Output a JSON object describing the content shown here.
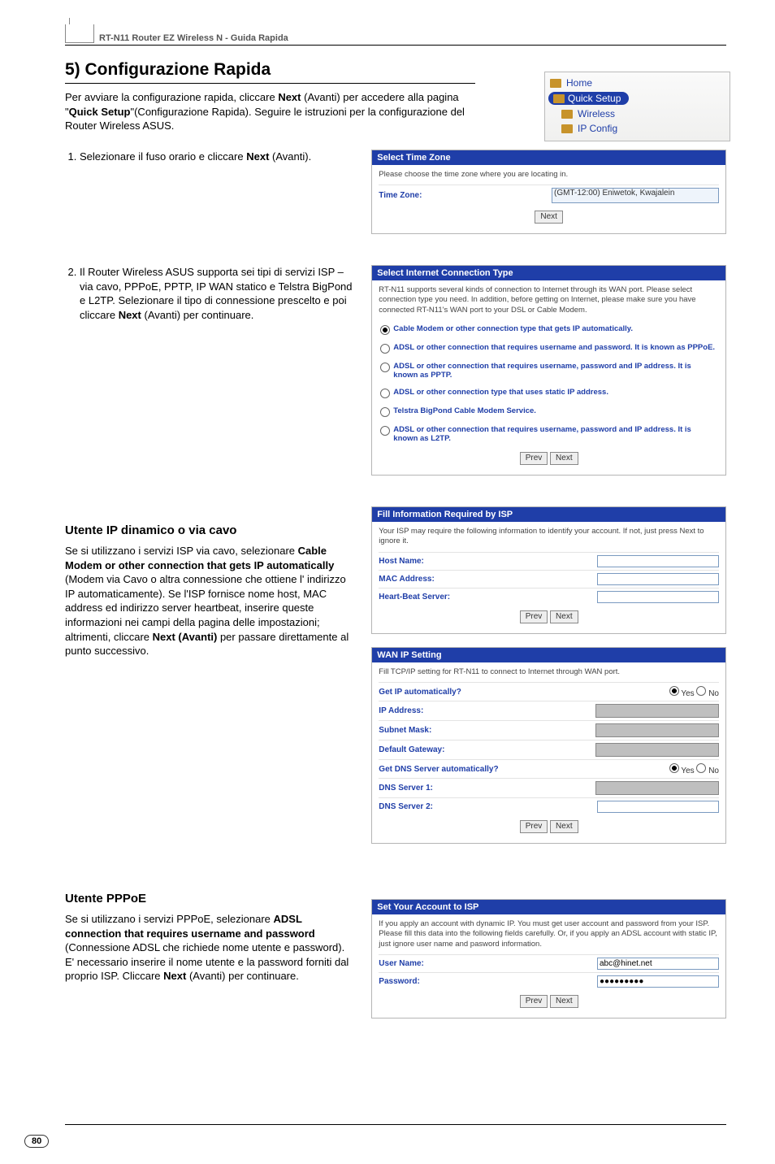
{
  "header": "RT-N11 Router EZ Wireless N - Guida Rapida",
  "section_title": "5) Configurazione Rapida",
  "intro": "Per avviare la configurazione rapida, cliccare Next (Avanti) per accedere alla pagina \"Quick Setup\"(Configurazione Rapida). Seguire le istruzioni per la configurazione del Router Wireless ASUS.",
  "nav": {
    "home": "Home",
    "quick": "Quick Setup",
    "wireless": "Wireless",
    "ipconfig": "IP Config"
  },
  "step1": "Selezionare il fuso orario e cliccare Next (Avanti).",
  "step2": "Il Router Wireless ASUS  supporta sei tipi di servizi ISP – via cavo, PPPoE, PPTP, IP WAN statico e Telstra BigPond e L2TP. Selezionare il tipo di connessione prescelto e poi cliccare Next (Avanti) per continuare.",
  "dyn_head": "Utente IP dinamico o via cavo",
  "dyn_body": "Se si utilizzano i servizi ISP via cavo, selezionare Cable Modem or other connection that gets IP automatically (Modem via Cavo o altra connessione che ottiene l' indirizzo IP automaticamente). Se l'ISP fornisce nome host, MAC address ed indirizzo server heartbeat, inserire queste informazioni nei campi della pagina delle impostazioni; altrimenti, cliccare Next (Avanti) per passare direttamente al punto successivo.",
  "pppoe_head": "Utente PPPoE",
  "pppoe_body": "Se si utilizzano i servizi PPPoE, selezionare ADSL connection that requires username and password (Connessione ADSL che richiede nome utente e password). E' necessario inserire il nome utente e la password forniti dal proprio ISP. Cliccare Next (Avanti) per continuare.",
  "panel_tz": {
    "title": "Select Time Zone",
    "desc": "Please choose the time zone where you are locating in.",
    "label": "Time Zone:",
    "value": "(GMT-12:00) Eniwetok, Kwajalein",
    "next": "Next"
  },
  "panel_conn": {
    "title": "Select Internet Connection Type",
    "desc": "RT-N11 supports several kinds of connection to Internet through its WAN port. Please select connection type you need. In addition, before getting on Internet, please make sure you have connected  RT-N11's WAN port to your DSL or Cable Modem.",
    "opt1": "Cable Modem or other connection type that gets IP automatically.",
    "opt2": "ADSL or other connection that requires username and password. It is known as PPPoE.",
    "opt3": "ADSL or other connection that requires username, password and IP address. It is known as PPTP.",
    "opt4": "ADSL or other connection type that uses static IP address.",
    "opt5": "Telstra BigPond Cable Modem Service.",
    "opt6": "ADSL or other connection that requires username, password and IP address. It is known as L2TP.",
    "prev": "Prev",
    "next": "Next"
  },
  "panel_isp": {
    "title": "Fill Information Required by ISP",
    "desc": "Your ISP may require the following information to identify your account. If not, just press Next to ignore it.",
    "host": "Host Name:",
    "mac": "MAC Address:",
    "hb": "Heart-Beat Server:",
    "prev": "Prev",
    "next": "Next"
  },
  "panel_wan": {
    "title": "WAN IP Setting",
    "desc": "Fill TCP/IP setting for RT-N11 to connect to Internet through WAN port.",
    "auto": "Get IP automatically?",
    "ip": "IP Address:",
    "mask": "Subnet Mask:",
    "gw": "Default Gateway:",
    "dnsauto": "Get DNS Server automatically?",
    "dns1": "DNS Server 1:",
    "dns2": "DNS Server 2:",
    "yes": "Yes",
    "no": "No",
    "prev": "Prev",
    "next": "Next"
  },
  "panel_acc": {
    "title": "Set Your Account to ISP",
    "desc": "If you apply an account with dynamic IP. You must get user account and password from your ISP. Please fill this data into the following fields carefully. Or, if you apply an ADSL account with static IP, just ignore user name and pasword information.",
    "user": "User Name:",
    "user_val": "abc@hinet.net",
    "pass": "Password:",
    "pass_val": "●●●●●●●●●",
    "prev": "Prev",
    "next": "Next"
  },
  "page_number": "80",
  "chart_data": {
    "type": "table",
    "title": "Guida Rapida – Pannelli di configurazione",
    "panels": [
      {
        "name": "Select Time Zone",
        "fields": [
          {
            "label": "Time Zone",
            "value": "(GMT-12:00) Eniwetok, Kwajalein",
            "type": "select"
          }
        ],
        "buttons": [
          "Next"
        ]
      },
      {
        "name": "Select Internet Connection Type",
        "options": [
          {
            "label": "Cable Modem or other connection type that gets IP automatically.",
            "selected": true
          },
          {
            "label": "ADSL or other connection that requires username and password. It is known as PPPoE.",
            "selected": false
          },
          {
            "label": "ADSL or other connection that requires username, password and IP address. It is known as PPTP.",
            "selected": false
          },
          {
            "label": "ADSL or other connection type that uses static IP address.",
            "selected": false
          },
          {
            "label": "Telstra BigPond Cable Modem Service.",
            "selected": false
          },
          {
            "label": "ADSL or other connection that requires username, password and IP address. It is known as L2TP.",
            "selected": false
          }
        ],
        "buttons": [
          "Prev",
          "Next"
        ]
      },
      {
        "name": "Fill Information Required by ISP",
        "fields": [
          {
            "label": "Host Name",
            "value": "",
            "type": "text"
          },
          {
            "label": "MAC Address",
            "value": "",
            "type": "text"
          },
          {
            "label": "Heart-Beat Server",
            "value": "",
            "type": "text"
          }
        ],
        "buttons": [
          "Prev",
          "Next"
        ]
      },
      {
        "name": "WAN IP Setting",
        "fields": [
          {
            "label": "Get IP automatically?",
            "value": "Yes",
            "type": "radio",
            "options": [
              "Yes",
              "No"
            ]
          },
          {
            "label": "IP Address",
            "value": "",
            "type": "text",
            "disabled": true
          },
          {
            "label": "Subnet Mask",
            "value": "",
            "type": "text",
            "disabled": true
          },
          {
            "label": "Default Gateway",
            "value": "",
            "type": "text",
            "disabled": true
          },
          {
            "label": "Get DNS Server automatically?",
            "value": "Yes",
            "type": "radio",
            "options": [
              "Yes",
              "No"
            ]
          },
          {
            "label": "DNS Server 1",
            "value": "",
            "type": "text",
            "disabled": true
          },
          {
            "label": "DNS Server 2",
            "value": "",
            "type": "text"
          }
        ],
        "buttons": [
          "Prev",
          "Next"
        ]
      },
      {
        "name": "Set Your Account to ISP",
        "fields": [
          {
            "label": "User Name",
            "value": "abc@hinet.net",
            "type": "text"
          },
          {
            "label": "Password",
            "value": "●●●●●●●●●",
            "type": "password"
          }
        ],
        "buttons": [
          "Prev",
          "Next"
        ]
      }
    ]
  }
}
